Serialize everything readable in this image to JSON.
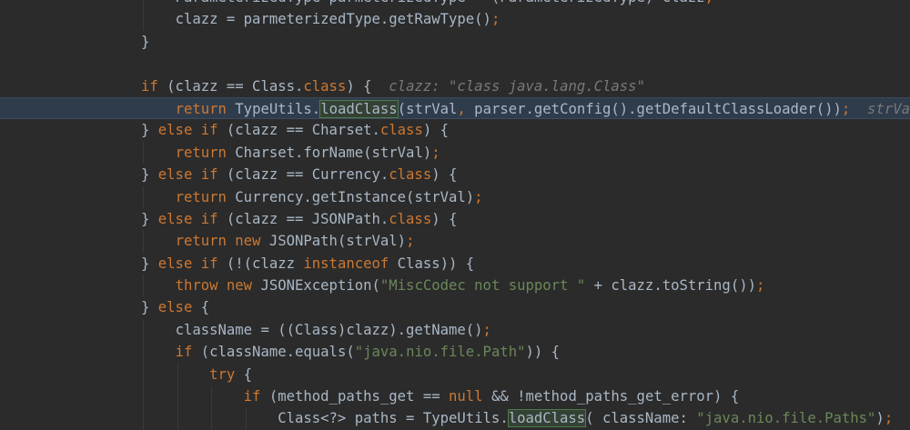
{
  "editor": {
    "current_line_index": 5,
    "colors": {
      "background": "#2b2b2b",
      "keyword": "#cc7832",
      "string": "#6a8759",
      "text": "#a9b7c6",
      "hint": "#787878",
      "current_line": "#2f3c4c"
    },
    "lines": [
      {
        "indent": 4,
        "tokens": [
          {
            "t": "ParameterizedType parmeterizedType = (ParameterizedType) clazz",
            "c": "plain"
          },
          {
            "t": ";",
            "c": "kw"
          }
        ]
      },
      {
        "indent": 4,
        "tokens": [
          {
            "t": "clazz = parmeterizedType.getRawType()",
            "c": "plain"
          },
          {
            "t": ";",
            "c": "kw"
          }
        ]
      },
      {
        "indent": 0,
        "tokens": [
          {
            "t": "}",
            "c": "plain"
          }
        ]
      },
      {
        "indent": 0,
        "tokens": []
      },
      {
        "indent": 0,
        "tokens": [
          {
            "t": "if",
            "c": "kw"
          },
          {
            "t": " (clazz == Class.",
            "c": "plain"
          },
          {
            "t": "class",
            "c": "kw"
          },
          {
            "t": ") {  ",
            "c": "plain"
          },
          {
            "t": "clazz: ",
            "c": "hint"
          },
          {
            "t": "\"class java.lang.Class\"",
            "c": "hint"
          }
        ]
      },
      {
        "indent": 4,
        "tokens": [
          {
            "t": "return",
            "c": "kw"
          },
          {
            "t": " TypeUtils.",
            "c": "plain"
          },
          {
            "t": "loadClass",
            "c": "plain hl"
          },
          {
            "t": "(strVal",
            "c": "plain"
          },
          {
            "t": ",",
            "c": "kw"
          },
          {
            "t": " parser.getConfig().getDefaultClassLoader())",
            "c": "plain"
          },
          {
            "t": ";",
            "c": "kw"
          },
          {
            "t": "  strVal",
            "c": "hint"
          }
        ]
      },
      {
        "indent": 0,
        "tokens": [
          {
            "t": "} ",
            "c": "plain"
          },
          {
            "t": "else if",
            "c": "kw"
          },
          {
            "t": " (clazz == Charset.",
            "c": "plain"
          },
          {
            "t": "class",
            "c": "kw"
          },
          {
            "t": ") {",
            "c": "plain"
          }
        ]
      },
      {
        "indent": 4,
        "tokens": [
          {
            "t": "return",
            "c": "kw"
          },
          {
            "t": " Charset.forName(strVal)",
            "c": "plain"
          },
          {
            "t": ";",
            "c": "kw"
          }
        ]
      },
      {
        "indent": 0,
        "tokens": [
          {
            "t": "} ",
            "c": "plain"
          },
          {
            "t": "else if",
            "c": "kw"
          },
          {
            "t": " (clazz == Currency.",
            "c": "plain"
          },
          {
            "t": "class",
            "c": "kw"
          },
          {
            "t": ") {",
            "c": "plain"
          }
        ]
      },
      {
        "indent": 4,
        "tokens": [
          {
            "t": "return",
            "c": "kw"
          },
          {
            "t": " Currency.getInstance(strVal)",
            "c": "plain"
          },
          {
            "t": ";",
            "c": "kw"
          }
        ]
      },
      {
        "indent": 0,
        "tokens": [
          {
            "t": "} ",
            "c": "plain"
          },
          {
            "t": "else if",
            "c": "kw"
          },
          {
            "t": " (clazz == JSONPath.",
            "c": "plain"
          },
          {
            "t": "class",
            "c": "kw"
          },
          {
            "t": ") {",
            "c": "plain"
          }
        ]
      },
      {
        "indent": 4,
        "tokens": [
          {
            "t": "return new",
            "c": "kw"
          },
          {
            "t": " JSONPath(strVal)",
            "c": "plain"
          },
          {
            "t": ";",
            "c": "kw"
          }
        ]
      },
      {
        "indent": 0,
        "tokens": [
          {
            "t": "} ",
            "c": "plain"
          },
          {
            "t": "else if",
            "c": "kw"
          },
          {
            "t": " (!(clazz ",
            "c": "plain"
          },
          {
            "t": "instanceof",
            "c": "kw"
          },
          {
            "t": " Class)) {",
            "c": "plain"
          }
        ]
      },
      {
        "indent": 4,
        "tokens": [
          {
            "t": "throw new",
            "c": "kw"
          },
          {
            "t": " JSONException(",
            "c": "plain"
          },
          {
            "t": "\"MiscCodec not support \"",
            "c": "str"
          },
          {
            "t": " + clazz.toString())",
            "c": "plain"
          },
          {
            "t": ";",
            "c": "kw"
          }
        ]
      },
      {
        "indent": 0,
        "tokens": [
          {
            "t": "} ",
            "c": "plain"
          },
          {
            "t": "else",
            "c": "kw"
          },
          {
            "t": " {",
            "c": "plain"
          }
        ]
      },
      {
        "indent": 4,
        "tokens": [
          {
            "t": "className = ((Class)clazz).getName()",
            "c": "plain"
          },
          {
            "t": ";",
            "c": "kw"
          }
        ]
      },
      {
        "indent": 4,
        "tokens": [
          {
            "t": "if",
            "c": "kw"
          },
          {
            "t": " (className.equals(",
            "c": "plain"
          },
          {
            "t": "\"java.nio.file.Path\"",
            "c": "str"
          },
          {
            "t": ")) {",
            "c": "plain"
          }
        ]
      },
      {
        "indent": 8,
        "tokens": [
          {
            "t": "try",
            "c": "kw"
          },
          {
            "t": " {",
            "c": "plain"
          }
        ]
      },
      {
        "indent": 12,
        "tokens": [
          {
            "t": "if",
            "c": "kw"
          },
          {
            "t": " (method_paths_get == ",
            "c": "plain"
          },
          {
            "t": "null",
            "c": "kw"
          },
          {
            "t": " && !method_paths_get_error) {",
            "c": "plain"
          }
        ]
      },
      {
        "indent": 16,
        "tokens": [
          {
            "t": "Class<?> paths = TypeUtils.",
            "c": "plain"
          },
          {
            "t": "loadClass",
            "c": "plain hl"
          },
          {
            "t": "( className: ",
            "c": "plain"
          },
          {
            "t": "\"java.nio.file.Paths\"",
            "c": "str"
          },
          {
            "t": ")",
            "c": "plain"
          },
          {
            "t": ";",
            "c": "kw"
          }
        ]
      }
    ]
  }
}
